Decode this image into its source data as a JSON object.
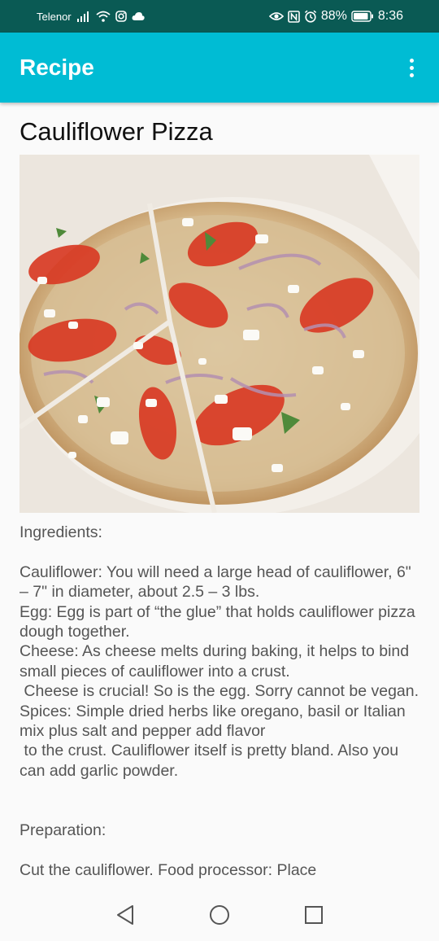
{
  "status_bar": {
    "carrier": "Telenor",
    "battery": "88%",
    "time": "8:36"
  },
  "app_bar": {
    "title": "Recipe"
  },
  "recipe": {
    "title": "Cauliflower Pizza",
    "body": "Ingredients:\n\nCauliflower: You will need a large head of cauliflower, 6\" – 7\" in diameter, about 2.5 – 3 lbs.\nEgg: Egg is part of “the glue” that holds cauliflower pizza dough together.\nCheese: As cheese melts during baking, it helps to bind small pieces of cauliflower into a crust.\n Cheese is crucial! So is the egg. Sorry cannot be vegan.\nSpices: Simple dried herbs like oregano, basil or Italian mix plus salt and pepper add flavor\n to the crust. Cauliflower itself is pretty bland. Also you can add garlic powder.\n\n\nPreparation:\n\nCut the cauliflower. Food processor: Place"
  },
  "colors": {
    "status_bar": "#0a5a54",
    "app_bar": "#00bcd4",
    "text": "#555555"
  }
}
